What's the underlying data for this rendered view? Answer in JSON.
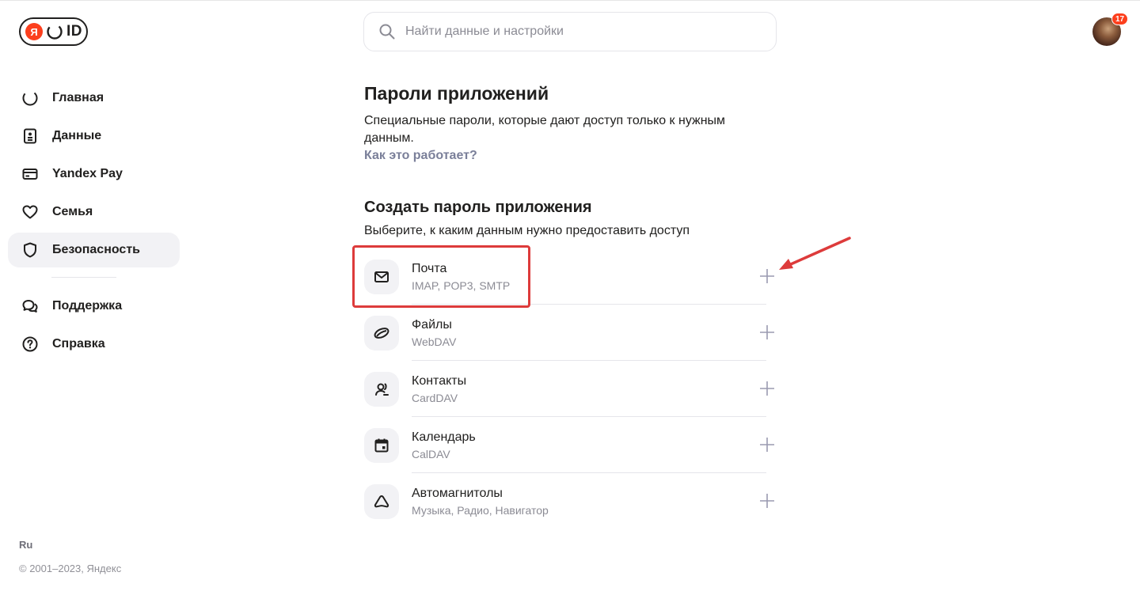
{
  "logo": {
    "ya": "Я",
    "id": "ID"
  },
  "search": {
    "placeholder": "Найти данные и настройки"
  },
  "avatar": {
    "badge": "17"
  },
  "sidebar": {
    "items": [
      {
        "label": "Главная",
        "icon": "home-smile-icon"
      },
      {
        "label": "Данные",
        "icon": "id-card-icon"
      },
      {
        "label": "Yandex Pay",
        "icon": "credit-card-icon"
      },
      {
        "label": "Семья",
        "icon": "heart-icon"
      },
      {
        "label": "Безопасность",
        "icon": "shield-icon",
        "active": true
      }
    ],
    "secondary": [
      {
        "label": "Поддержка",
        "icon": "chat-icon"
      },
      {
        "label": "Справка",
        "icon": "question-icon"
      }
    ]
  },
  "footer": {
    "lang": "Ru",
    "copyright": "© 2001–2023, Яндекс"
  },
  "main": {
    "title": "Пароли приложений",
    "description": "Специальные пароли, которые дают доступ только к нужным данным.",
    "how_link": "Как это работает?",
    "create_title": "Создать пароль приложения",
    "create_desc": "Выберите, к каким данным нужно предоставить доступ",
    "apps": [
      {
        "title": "Почта",
        "subtitle": "IMAP, POP3, SMTP",
        "icon": "mail-icon"
      },
      {
        "title": "Файлы",
        "subtitle": "WebDAV",
        "icon": "disk-icon"
      },
      {
        "title": "Контакты",
        "subtitle": "CardDAV",
        "icon": "contacts-icon"
      },
      {
        "title": "Календарь",
        "subtitle": "CalDAV",
        "icon": "calendar-icon"
      },
      {
        "title": "Автомагнитолы",
        "subtitle": "Музыка, Радио, Навигатор",
        "icon": "car-icon"
      }
    ]
  },
  "colors": {
    "accent_red": "#fc3f1d",
    "annotation_red": "#dd3b3b",
    "link": "#7a7f99",
    "active_bg": "#f2f2f5"
  }
}
